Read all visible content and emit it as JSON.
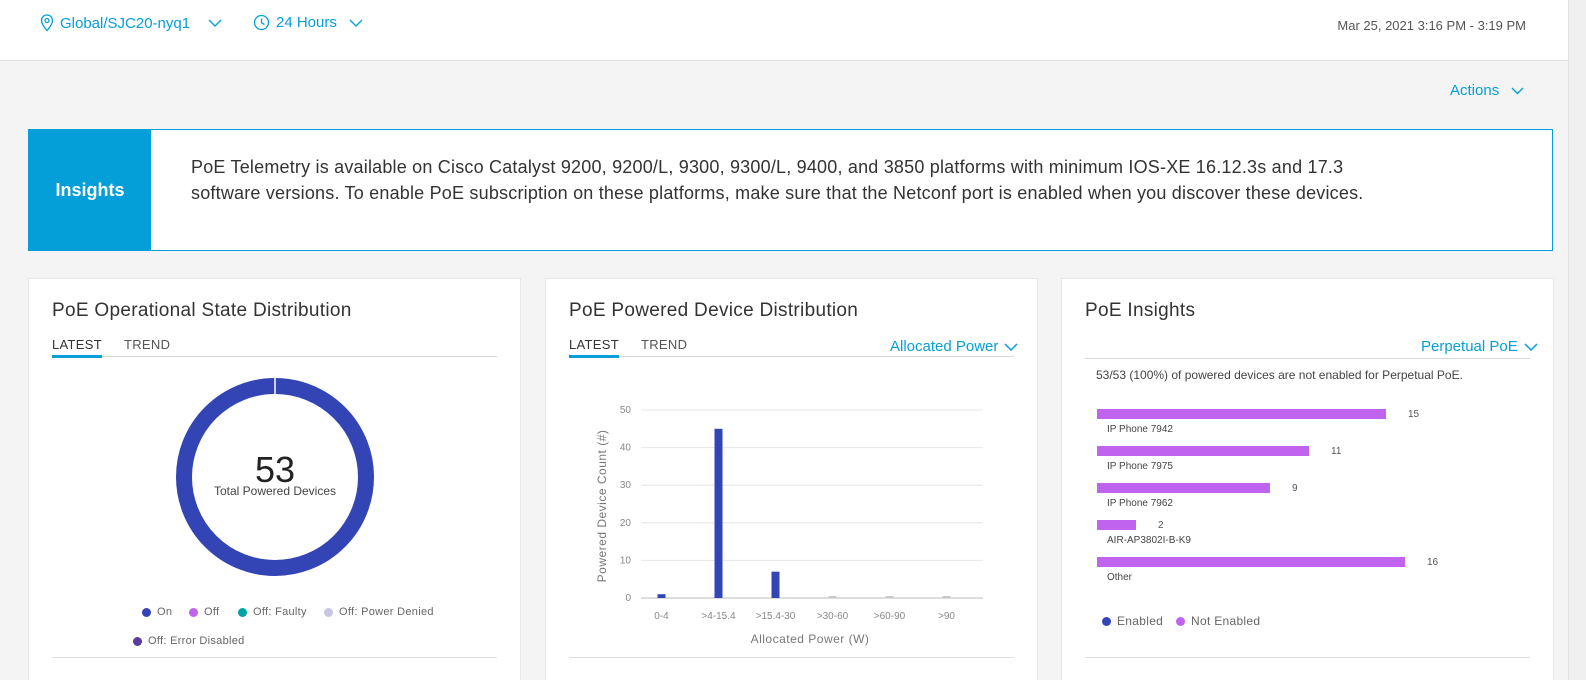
{
  "topbar": {
    "location": "Global/SJC20-nyq1",
    "timerange": "24 Hours",
    "timestamp": "Mar 25, 2021 3:16 PM - 3:19 PM"
  },
  "actions_label": "Actions",
  "insights": {
    "tag": "Insights",
    "line1": "PoE Telemetry is available on Cisco Catalyst 9200, 9200/L, 9300, 9300/L, 9400, and 3850 platforms with minimum IOS-XE 16.12.3s and 17.3",
    "line2": "software versions. To enable PoE subscription on these platforms, make sure that the Netconf port is enabled when you discover these devices."
  },
  "card1": {
    "title": "PoE Operational State Distribution",
    "tabs": [
      "LATEST",
      "TREND"
    ],
    "total": "53",
    "total_label": "Total Powered Devices",
    "legend": [
      {
        "label": "On",
        "color": "#3344b5"
      },
      {
        "label": "Off",
        "color": "#c064f0"
      },
      {
        "label": "Off: Faulty",
        "color": "#00a3a3"
      },
      {
        "label": "Off: Power Denied",
        "color": "#c8c4e4"
      },
      {
        "label": "Off: Error Disabled",
        "color": "#5a3aa0"
      }
    ]
  },
  "card2": {
    "title": "PoE Powered Device Distribution",
    "tabs": [
      "LATEST",
      "TREND"
    ],
    "dropdown": "Allocated Power"
  },
  "card3": {
    "title": "PoE Insights",
    "dropdown": "Perpetual PoE",
    "summary": "53/53 (100%) of powered devices are not enabled for Perpetual PoE.",
    "rows": [
      {
        "label": "IP Phone 7942",
        "value": 15
      },
      {
        "label": "IP Phone 7975",
        "value": 11
      },
      {
        "label": "IP Phone 7962",
        "value": 9
      },
      {
        "label": "AIR-AP3802I-B-K9",
        "value": 2
      },
      {
        "label": "Other",
        "value": 16
      }
    ],
    "legend": [
      {
        "label": "Enabled",
        "color": "#3344b5"
      },
      {
        "label": "Not Enabled",
        "color": "#c064f0"
      }
    ]
  },
  "chart_data": {
    "type": "bar",
    "categories": [
      "0-4",
      ">4-15.4",
      ">15.4-30",
      ">30-60",
      ">60-90",
      ">90"
    ],
    "values": [
      1,
      45,
      7,
      0,
      0,
      0
    ],
    "xlabel": "Allocated Power (W)",
    "ylabel": "Powered Device Count (#)",
    "ylim": [
      0,
      50
    ],
    "yticks": [
      0,
      10,
      20,
      30,
      40,
      50
    ],
    "color": "#3344b5"
  },
  "donut_data": {
    "type": "pie",
    "categories": [
      "On"
    ],
    "values": [
      53
    ],
    "color": "#3344b5"
  }
}
